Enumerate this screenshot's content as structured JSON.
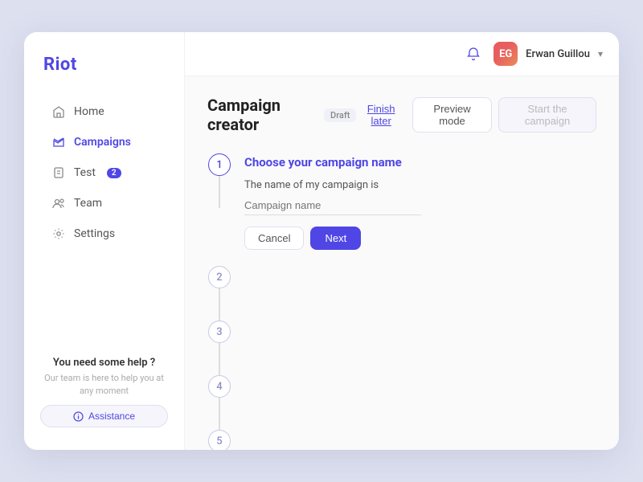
{
  "sidebar": {
    "logo": "Riot",
    "nav": [
      {
        "id": "home",
        "label": "Home",
        "icon": "home-icon",
        "active": false,
        "badge": null
      },
      {
        "id": "campaigns",
        "label": "Campaigns",
        "icon": "campaigns-icon",
        "active": true,
        "badge": null
      },
      {
        "id": "test",
        "label": "Test",
        "icon": "test-icon",
        "active": false,
        "badge": "2"
      },
      {
        "id": "team",
        "label": "Team",
        "icon": "team-icon",
        "active": false,
        "badge": null
      },
      {
        "id": "settings",
        "label": "Settings",
        "icon": "settings-icon",
        "active": false,
        "badge": null
      }
    ],
    "help": {
      "title": "You need some help ?",
      "text": "Our team is here to help you at any moment",
      "button": "Assistance"
    }
  },
  "topbar": {
    "username": "Erwan Guillou",
    "avatar_initials": "EG"
  },
  "page": {
    "title": "Campaign creator",
    "badge": "Draft",
    "actions": {
      "finish_later": "Finish later",
      "preview_mode": "Preview mode",
      "start_campaign": "Start the campaign"
    }
  },
  "stepper": {
    "steps": [
      {
        "number": "1",
        "active": true
      },
      {
        "number": "2",
        "active": false
      },
      {
        "number": "3",
        "active": false
      },
      {
        "number": "4",
        "active": false
      },
      {
        "number": "5",
        "active": false
      }
    ],
    "step1": {
      "title": "Choose your campaign name",
      "label": "The name of my campaign is",
      "placeholder": "Campaign name",
      "cancel": "Cancel",
      "next": "Next"
    }
  }
}
